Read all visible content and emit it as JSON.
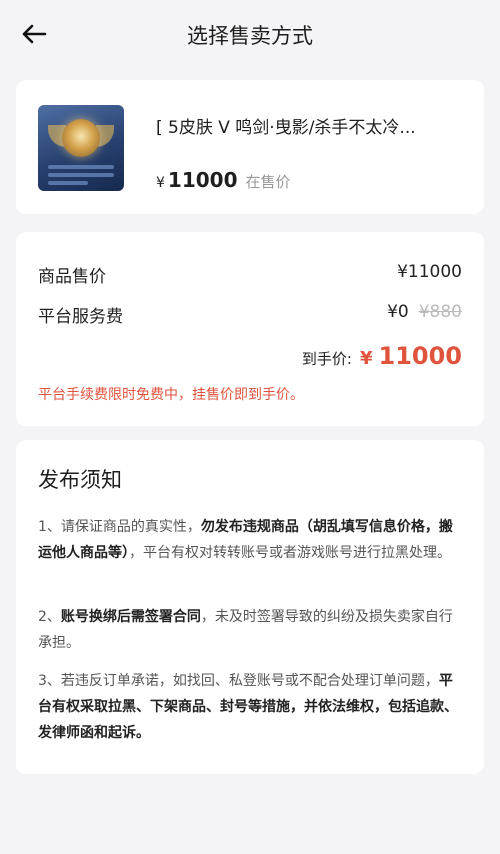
{
  "header": {
    "title": "选择售卖方式"
  },
  "product": {
    "title": "[  5皮肤 V   鸣剑·曳影/杀手不太冷...",
    "currency": "¥",
    "price": "11000",
    "status": "在售价"
  },
  "fees": {
    "sale_label": "商品售价",
    "sale_value": "¥11000",
    "service_label": "平台服务费",
    "service_value": "¥0",
    "service_original": "¥880",
    "receive_label": "到手价:",
    "receive_currency": "¥",
    "receive_value": "11000",
    "promo": "平台手续费限时免费中，挂售价即到手价。"
  },
  "notice": {
    "title": "发布须知",
    "n1_a": "1、请保证商品的真实性，",
    "n1_b": "勿发布违规商品（胡乱填写信息价格，搬运他人商品等）",
    "n1_c": "，平台有权对转转账号或者游戏账号进行拉黑处理。",
    "n2_a": "2、",
    "n2_b": "账号换绑后需签署合同",
    "n2_c": "，未及时签署导致的纠纷及损失卖家自行承担。",
    "n3_a": "3、若违反订单承诺，如找回、私登账号或不配合处理订单问题，",
    "n3_b": "平台有权采取拉黑、下架商品、封号等措施，并依法维权，包括追款、发律师函和起诉。"
  },
  "colors": {
    "accent": "#e0533c",
    "background": "#f4f4f6",
    "muted": "#999999"
  },
  "icons": {
    "back": "back-arrow-icon"
  }
}
